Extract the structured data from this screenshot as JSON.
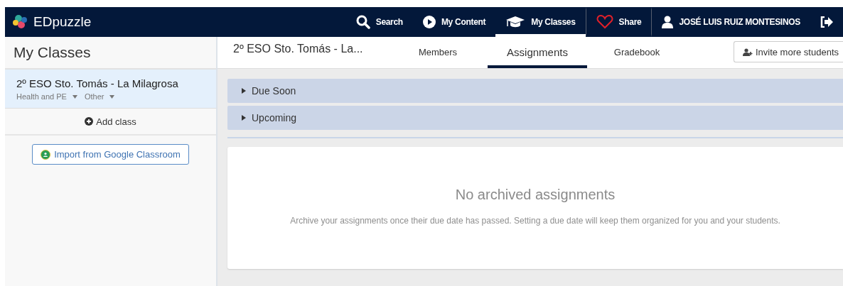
{
  "brand": {
    "name": "EDpuzzle"
  },
  "nav": [
    {
      "kind": "search",
      "label": "Search",
      "selected": false
    },
    {
      "kind": "content",
      "label": "My Content",
      "selected": false
    },
    {
      "kind": "classes",
      "label": "My Classes",
      "selected": true
    },
    {
      "kind": "share",
      "label": "Share",
      "selected": false
    },
    {
      "kind": "user",
      "label": "JOSÉ LUIS RUIZ MONTESINOS",
      "selected": false
    },
    {
      "kind": "logout",
      "selected": false
    }
  ],
  "sidebar": {
    "title": "My Classes",
    "classes": [
      {
        "name": "2º ESO Sto. Tomás - La Milagrosa",
        "subject": "Health and PE",
        "grade": "Other",
        "selected": true
      }
    ],
    "add_class": "Add class",
    "import_button": "Import from Google Classroom"
  },
  "header": {
    "class_title": "2º ESO Sto. Tomás - La...",
    "tabs": [
      {
        "label": "Members",
        "selected": false
      },
      {
        "label": "Assignments",
        "selected": true
      },
      {
        "label": "Gradebook",
        "selected": false
      }
    ],
    "invite_button": "Invite more students"
  },
  "sections": [
    {
      "label": "Due Soon",
      "expanded": false
    },
    {
      "label": "Upcoming",
      "expanded": false
    }
  ],
  "empty_state": {
    "title": "No archived assignments",
    "message": "Archive your assignments once their due date has passed. Setting a due date will keep them organized for you and your students."
  }
}
